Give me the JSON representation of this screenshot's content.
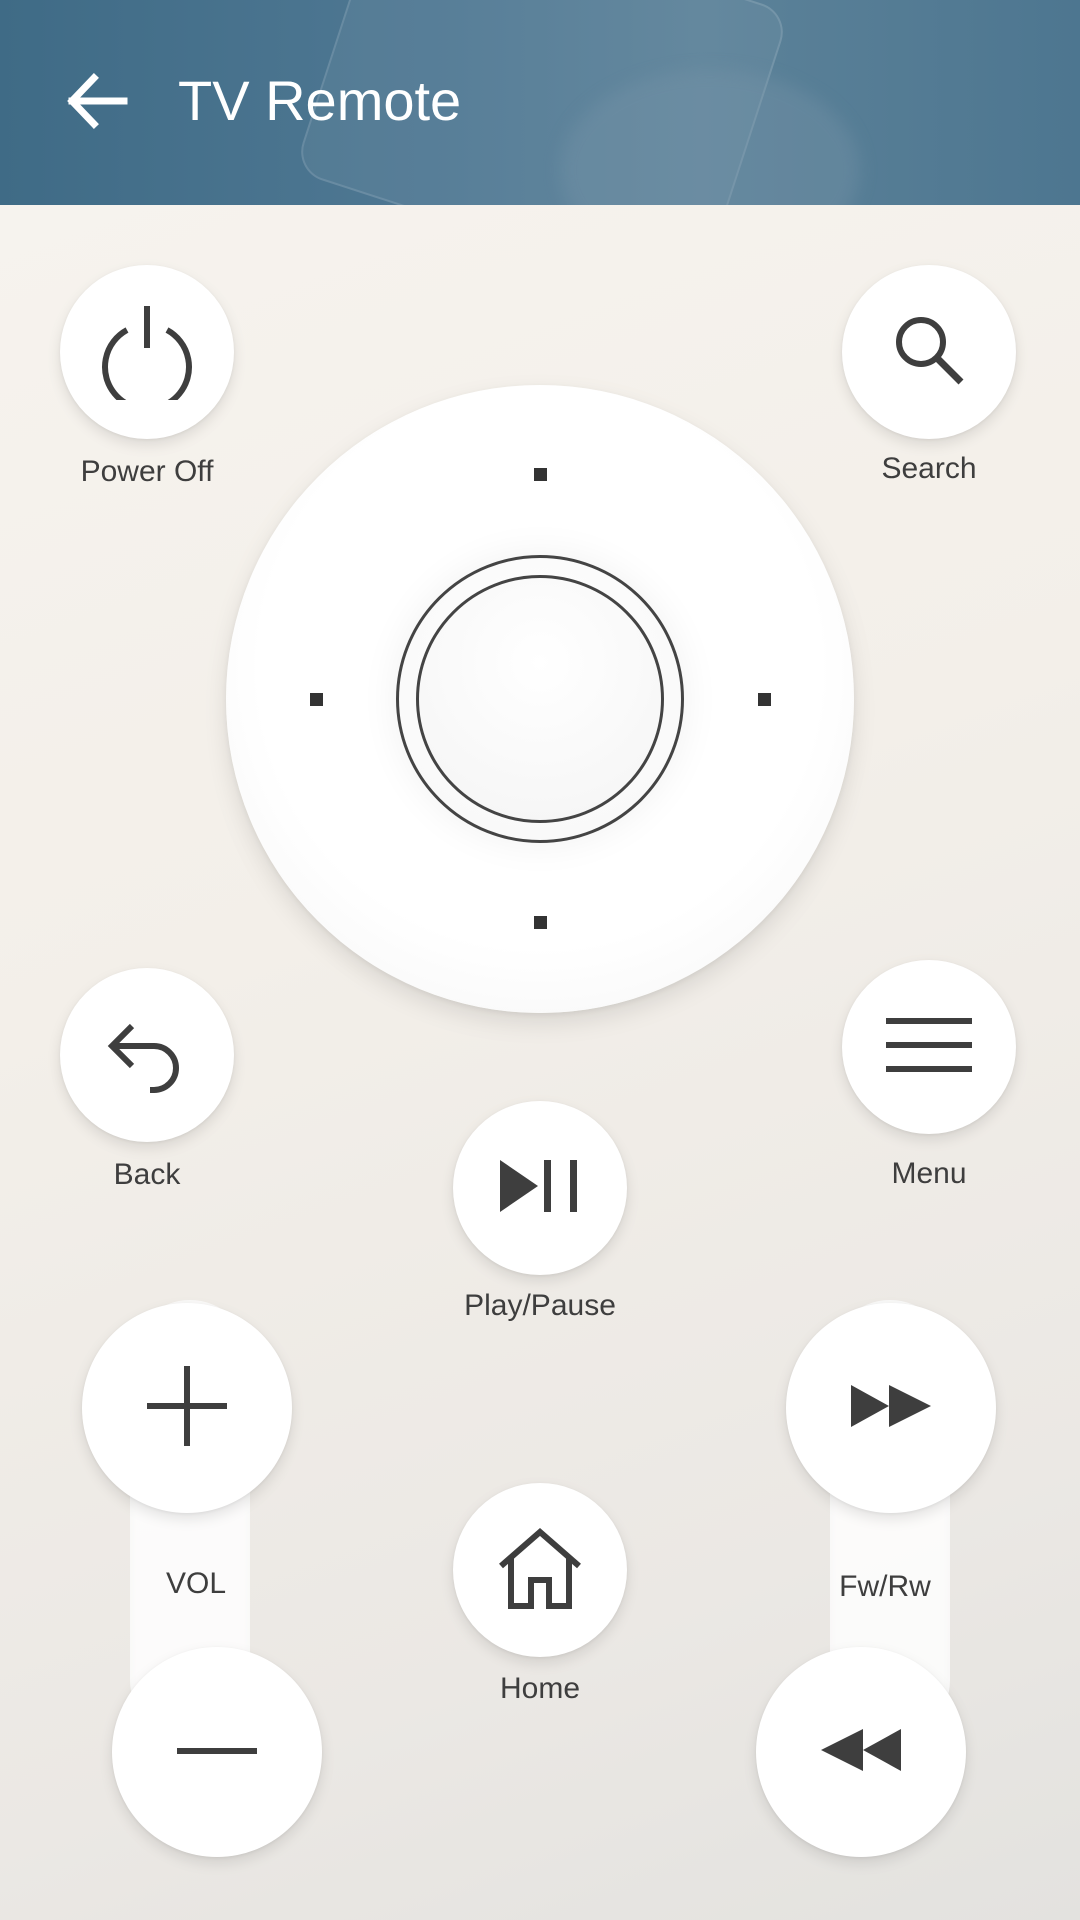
{
  "app_bar": {
    "title": "TV Remote",
    "back_icon": "arrow-left-icon"
  },
  "buttons": {
    "power": {
      "label": "Power Off",
      "icon": "power-icon"
    },
    "search": {
      "label": "Search",
      "icon": "search-icon"
    },
    "back": {
      "label": "Back",
      "icon": "back-reply-icon"
    },
    "menu": {
      "label": "Menu",
      "icon": "menu-icon"
    },
    "play_pause": {
      "label": "Play/Pause",
      "icon": "play-pause-icon"
    },
    "home": {
      "label": "Home",
      "icon": "home-icon"
    },
    "volume": {
      "label": "VOL",
      "up_icon": "plus-icon",
      "down_icon": "minus-icon"
    },
    "fw_rw": {
      "label": "Fw/Rw",
      "forward_icon": "fast-forward-icon",
      "rewind_icon": "rewind-icon"
    }
  },
  "colors": {
    "app_bar": "#4a7591",
    "icon": "#3e3e3e",
    "button_bg": "#ffffff"
  }
}
